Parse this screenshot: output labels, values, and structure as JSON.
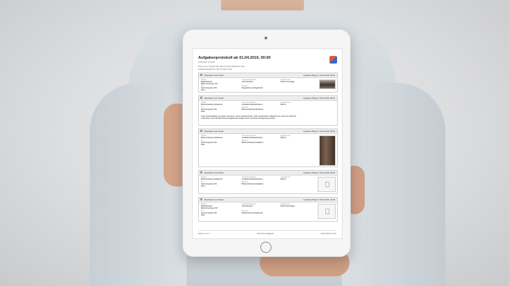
{
  "report": {
    "title": "Aufgabenprotokoll ab 01.04.2019, 00:00",
    "company": "pdfokbo GmbH",
    "filters_line1": "Prime Neu  Projekt Alle  Bereich Alle  Mitarbeiter Alle",
    "filters_line2": "Aufgabenkategorie Alle  Gruppen Alle"
  },
  "tasks": [
    {
      "status": "Bearbeiten Von Kinder",
      "date": "Geplanter Beginn: 05.04.2019, 08:30",
      "c1": [
        "Objekt",
        "Begleichsaner",
        "Baumschutzweg 154"
      ],
      "c2": [
        "Verantwortlichkeit",
        "Administration"
      ],
      "c3": [
        "Aufgabenart",
        "Rohrrinnenanlage"
      ],
      "c4": [
        "Ort",
        "Gehmarngasse 264",
        "Wien"
      ],
      "c5": [
        "Bereich",
        "Begutachtung Fliegedecke"
      ]
    },
    {
      "status": "Bearbeiten Von Kinder",
      "date": "Geplanter Beginn: 05.04.2019, 08:51",
      "c1": [
        "Objekt",
        "Bodenerhaltung Kabelkrien"
      ],
      "c2": [
        "Verantwortlichkeit",
        "Installationsliebelebrations"
      ],
      "c3": [
        "Aufgabenart",
        "Warme"
      ],
      "c4": [
        "Ort",
        "Gehmarngasse 264",
        "Wien"
      ],
      "c5": [
        "Bereich",
        "Bodenerhaltung Kabelkrien"
      ],
      "desc": "Unter Ameisenklatten ist Lasser aversieren, deren wahrscheinlich - Echo wiederholen. Material muss nach dem Eintrock vorbereitet, womit die Behebung Ausgabeseite erfolgen kann und keine Verzögerung entsteht"
    },
    {
      "status": "Bearbeiten Von Kinder",
      "date": "Geplanter Beginn: 05.04.2019, 08:56",
      "c1": [
        "Objekt",
        "Bodenerhaltung Kabelkrien"
      ],
      "c2": [
        "Verantwortlichkeit",
        "Installationsliebelebrations"
      ],
      "c3": [
        "Aufgabenart",
        "Warme"
      ],
      "c4": [
        "Ort",
        "Gehmarngasse 264",
        "Wien"
      ],
      "c5": [
        "Bereich",
        "Bodenerhaltung Installation"
      ]
    },
    {
      "status": "Bearbeiten Von Kinder",
      "date": "Geplanter Beginn: 05.04.2019, 09:00",
      "c1": [
        "Objekt",
        "Bodenerhaltung Kabelkrien"
      ],
      "c2": [
        "Verantwortlichkeit",
        "Installationsliebelebrations"
      ],
      "c3": [
        "Aufgabenart",
        "Warme"
      ],
      "c4": [
        "Ort",
        "Gehmarngasse 264",
        "Wien"
      ],
      "c5": [
        "Bereich",
        "Bodenerhaltung Installation"
      ]
    },
    {
      "status": "Bearbeiten Von Kinder",
      "date": "Geplanter Beginn: 05.04.2019, 11:00",
      "c1": [
        "Objekt",
        "Begleichsaner",
        "Baumschutzweg 154"
      ],
      "c2": [
        "Verantwortlichkeit",
        "Administration"
      ],
      "c3": [
        "Aufgabenart",
        "Rohrrinnenanlage"
      ],
      "c4": [
        "Ort",
        "Gehmarngasse 264",
        "Wien"
      ],
      "c5": [
        "Bereich",
        "Begutachtung Fliegedecke"
      ]
    }
  ],
  "footer": {
    "page": "Seite 1 von 1",
    "center": "Nach Ihrer Maganit",
    "date": "05.04.2019, 13:37"
  },
  "colors": {
    "logo_orange": "#e8562a",
    "logo_blue": "#2d6bd6"
  }
}
